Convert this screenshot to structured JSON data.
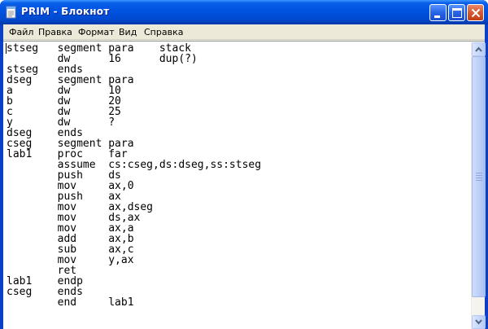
{
  "window": {
    "title": "PRIM - Блокнот",
    "app_icon": "notepad-icon",
    "controls": [
      "minimize-icon",
      "maximize-icon",
      "close-icon"
    ]
  },
  "menu": {
    "items": [
      "Файл",
      "Правка",
      "Формат",
      "Вид",
      "Справка"
    ]
  },
  "document": {
    "lines": [
      "stseg   segment para    stack",
      "        dw      16      dup(?)",
      "stseg   ends",
      "dseg    segment para",
      "a       dw      10",
      "b       dw      20",
      "c       dw      25",
      "y       dw      ?",
      "dseg    ends",
      "cseg    segment para",
      "lab1    proc    far",
      "        assume  cs:cseg,ds:dseg,ss:stseg",
      "        push    ds",
      "        mov     ax,0",
      "        push    ax",
      "        mov     ax,dseg",
      "        mov     ds,ax",
      "        mov     ax,a",
      "        add     ax,b",
      "        sub     ax,c",
      "        mov     y,ax",
      "        ret",
      "lab1    endp",
      "cseg    ends",
      "        end     lab1"
    ]
  },
  "scrollbar": {
    "up_icon": "scroll-up-arrow-icon",
    "down_icon": "scroll-down-arrow-icon"
  },
  "colors": {
    "titlebar": "#0054e3",
    "frame": "#ece9d8",
    "editor_bg": "#ffffff",
    "close_button": "#c03f14"
  }
}
